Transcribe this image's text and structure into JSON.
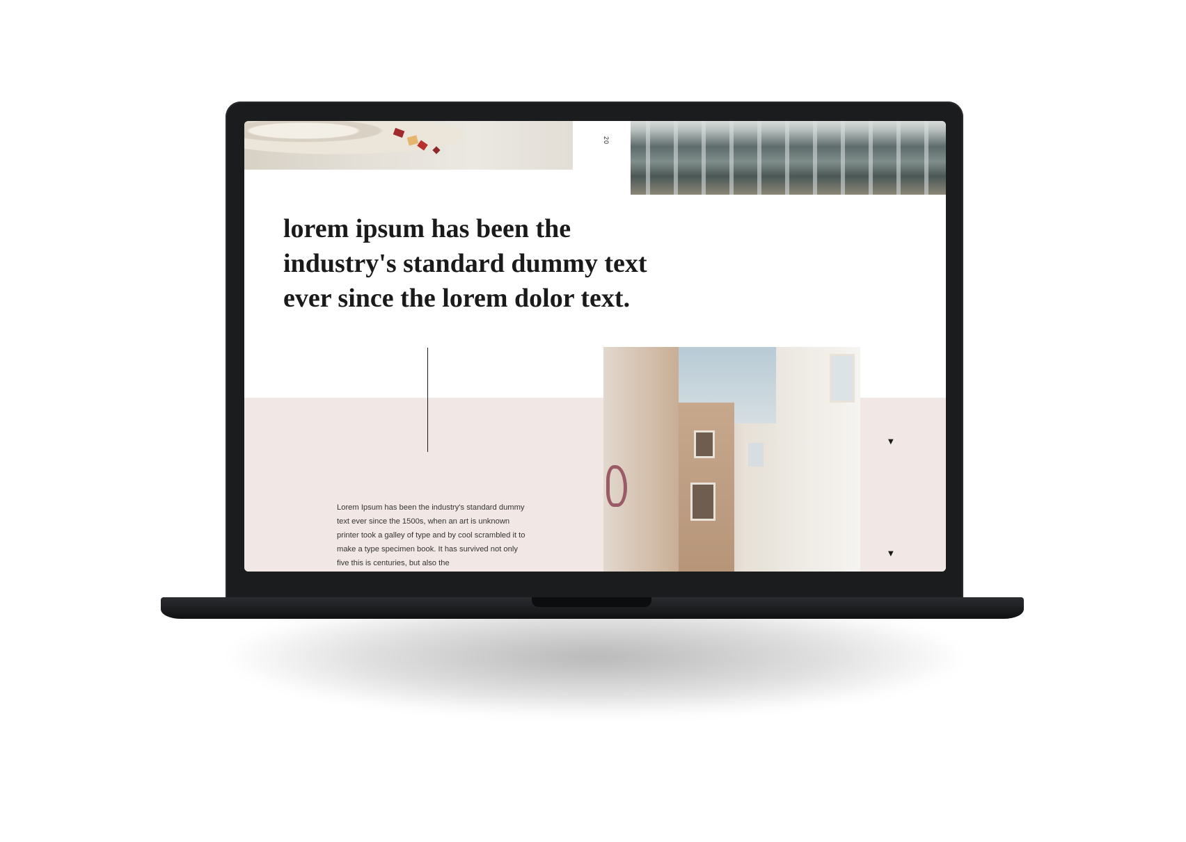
{
  "page": {
    "page_number": "20",
    "headline": "lorem ipsum has been the industry's standard dummy text ever since the lorem dolor text.",
    "body": "Lorem Ipsum has been the industry's standard dummy text ever since the 1500s, when an art is unknown printer took a galley of type and by cool scrambled it to make a type specimen book. It has survived not only five this is centuries, but also the",
    "arrows": [
      "▼",
      "▼"
    ]
  },
  "colors": {
    "accent_band": "#f1e8e5",
    "text": "#1a1a1a"
  }
}
